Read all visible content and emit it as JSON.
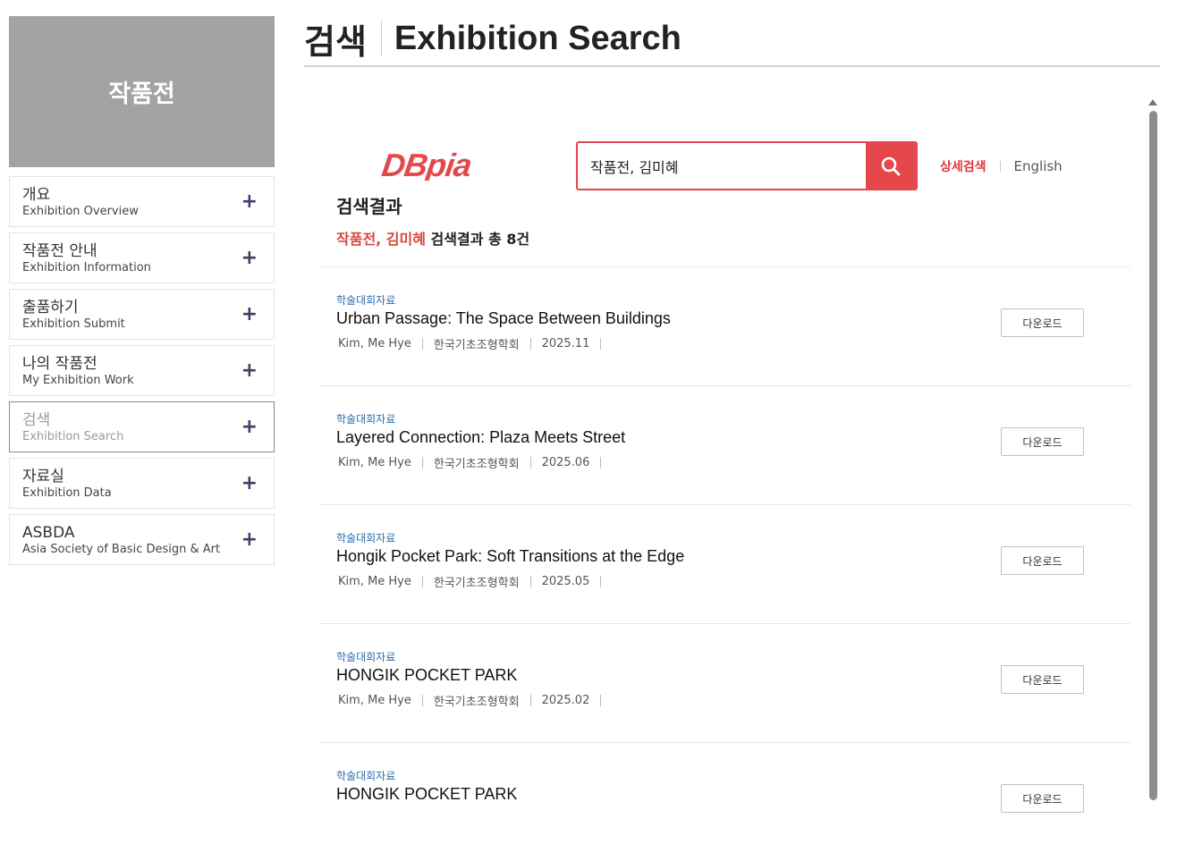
{
  "sidebar": {
    "title": "작품전",
    "items": [
      {
        "ko": "개요",
        "en": "Exhibition Overview"
      },
      {
        "ko": "작품전 안내",
        "en": "Exhibition Information"
      },
      {
        "ko": "출품하기",
        "en": "Exhibition Submit"
      },
      {
        "ko": "나의 작품전",
        "en": "My Exhibition Work"
      },
      {
        "ko": "검색",
        "en": "Exhibition Search"
      },
      {
        "ko": "자료실",
        "en": "Exhibition Data"
      },
      {
        "ko": "ASBDA",
        "en": "Asia Society of Basic Design & Art"
      }
    ],
    "expand_glyph": "+"
  },
  "header": {
    "title_ko": "검색",
    "title_en": "Exhibition Search"
  },
  "search": {
    "logo_text": "DBpia",
    "query": "작품전, 김미혜",
    "advanced_label": "상세검색",
    "english_label": "English"
  },
  "results": {
    "heading": "검색결과",
    "keyword": "작품전, 김미혜",
    "summary_text": "검색결과 총 8건",
    "download_label": "다운로드",
    "items": [
      {
        "category": "학술대회자료",
        "title": "Urban Passage: The Space Between Buildings",
        "author": "Kim, Me Hye",
        "publisher": "한국기초조형학회",
        "date": "2025.11"
      },
      {
        "category": "학술대회자료",
        "title": "Layered Connection: Plaza Meets Street",
        "author": "Kim, Me Hye",
        "publisher": "한국기초조형학회",
        "date": "2025.06"
      },
      {
        "category": "학술대회자료",
        "title": "Hongik Pocket Park: Soft Transitions at the Edge",
        "author": "Kim, Me Hye",
        "publisher": "한국기초조형학회",
        "date": "2025.05"
      },
      {
        "category": "학술대회자료",
        "title": "HONGIK POCKET PARK",
        "author": "Kim, Me Hye",
        "publisher": "한국기초조형학회",
        "date": "2025.02"
      },
      {
        "category": "학술대회자료",
        "title": "HONGIK POCKET PARK",
        "author": "",
        "publisher": "",
        "date": ""
      }
    ]
  },
  "colors": {
    "accent": "#e4474c",
    "sidebar_header": "#a3a3a3",
    "category": "#2a6db0"
  }
}
